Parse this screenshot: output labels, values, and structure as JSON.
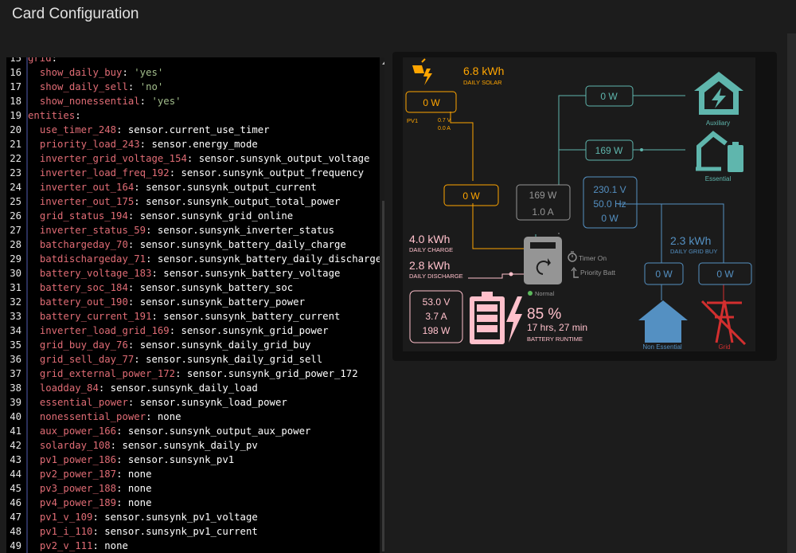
{
  "page": {
    "title": "Card Configuration"
  },
  "editor": {
    "lines": [
      {
        "n": "15",
        "key": "grid",
        "sep": ":",
        "val": "",
        "valType": "",
        "indent": 0
      },
      {
        "n": "16",
        "key": "show_daily_buy",
        "sep": ": ",
        "val": "'yes'",
        "valType": "s",
        "indent": 1
      },
      {
        "n": "17",
        "key": "show_daily_sell",
        "sep": ": ",
        "val": "'no'",
        "valType": "s",
        "indent": 1
      },
      {
        "n": "18",
        "key": "show_nonessential",
        "sep": ": ",
        "val": "'yes'",
        "valType": "s",
        "indent": 1
      },
      {
        "n": "19",
        "key": "entities",
        "sep": ":",
        "val": "",
        "valType": "",
        "indent": 0
      },
      {
        "n": "20",
        "key": "use_timer_248",
        "sep": ": ",
        "val": "sensor.current_use_timer",
        "valType": "p",
        "indent": 1
      },
      {
        "n": "21",
        "key": "priority_load_243",
        "sep": ": ",
        "val": "sensor.energy_mode",
        "valType": "p",
        "indent": 1
      },
      {
        "n": "22",
        "key": "inverter_grid_voltage_154",
        "sep": ": ",
        "val": "sensor.sunsynk_output_voltage",
        "valType": "p",
        "indent": 1
      },
      {
        "n": "23",
        "key": "inverter_load_freq_192",
        "sep": ": ",
        "val": "sensor.sunsynk_output_frequency",
        "valType": "p",
        "indent": 1
      },
      {
        "n": "24",
        "key": "inverter_out_164",
        "sep": ": ",
        "val": "sensor.sunsynk_output_current",
        "valType": "p",
        "indent": 1
      },
      {
        "n": "25",
        "key": "inverter_out_175",
        "sep": ": ",
        "val": "sensor.sunsynk_output_total_power",
        "valType": "p",
        "indent": 1
      },
      {
        "n": "26",
        "key": "grid_status_194",
        "sep": ": ",
        "val": "sensor.sunsynk_grid_online",
        "valType": "p",
        "indent": 1
      },
      {
        "n": "27",
        "key": "inverter_status_59",
        "sep": ": ",
        "val": "sensor.sunsynk_inverter_status",
        "valType": "p",
        "indent": 1
      },
      {
        "n": "28",
        "key": "batchargeday_70",
        "sep": ": ",
        "val": "sensor.sunsynk_battery_daily_charge",
        "valType": "p",
        "indent": 1
      },
      {
        "n": "29",
        "key": "batdischargeday_71",
        "sep": ": ",
        "val": "sensor.sunsynk_battery_daily_discharge",
        "valType": "p",
        "indent": 1
      },
      {
        "n": "30",
        "key": "battery_voltage_183",
        "sep": ": ",
        "val": "sensor.sunsynk_battery_voltage",
        "valType": "p",
        "indent": 1
      },
      {
        "n": "31",
        "key": "battery_soc_184",
        "sep": ": ",
        "val": "sensor.sunsynk_battery_soc",
        "valType": "p",
        "indent": 1
      },
      {
        "n": "32",
        "key": "battery_out_190",
        "sep": ": ",
        "val": "sensor.sunsynk_battery_power",
        "valType": "p",
        "indent": 1
      },
      {
        "n": "33",
        "key": "battery_current_191",
        "sep": ": ",
        "val": "sensor.sunsynk_battery_current",
        "valType": "p",
        "indent": 1
      },
      {
        "n": "34",
        "key": "inverter_load_grid_169",
        "sep": ": ",
        "val": "sensor.sunsynk_grid_power",
        "valType": "p",
        "indent": 1
      },
      {
        "n": "35",
        "key": "grid_buy_day_76",
        "sep": ": ",
        "val": "sensor.sunsynk_daily_grid_buy",
        "valType": "p",
        "indent": 1
      },
      {
        "n": "36",
        "key": "grid_sell_day_77",
        "sep": ": ",
        "val": "sensor.sunsynk_daily_grid_sell",
        "valType": "p",
        "indent": 1
      },
      {
        "n": "37",
        "key": "grid_external_power_172",
        "sep": ": ",
        "val": "sensor.sunsynk_grid_power_172",
        "valType": "p",
        "indent": 1
      },
      {
        "n": "38",
        "key": "loadday_84",
        "sep": ": ",
        "val": "sensor.sunsynk_daily_load",
        "valType": "p",
        "indent": 1
      },
      {
        "n": "39",
        "key": "essential_power",
        "sep": ": ",
        "val": "sensor.sunsynk_load_power",
        "valType": "p",
        "indent": 1
      },
      {
        "n": "40",
        "key": "nonessential_power",
        "sep": ": ",
        "val": "none",
        "valType": "p",
        "indent": 1
      },
      {
        "n": "41",
        "key": "aux_power_166",
        "sep": ": ",
        "val": "sensor.sunsynk_output_aux_power",
        "valType": "p",
        "indent": 1
      },
      {
        "n": "42",
        "key": "solarday_108",
        "sep": ": ",
        "val": "sensor.sunsynk_daily_pv",
        "valType": "p",
        "indent": 1
      },
      {
        "n": "43",
        "key": "pv1_power_186",
        "sep": ": ",
        "val": "sensor.sunsynk_pv1",
        "valType": "p",
        "indent": 1
      },
      {
        "n": "44",
        "key": "pv2_power_187",
        "sep": ": ",
        "val": "none",
        "valType": "p",
        "indent": 1
      },
      {
        "n": "45",
        "key": "pv3_power_188",
        "sep": ": ",
        "val": "none",
        "valType": "p",
        "indent": 1
      },
      {
        "n": "46",
        "key": "pv4_power_189",
        "sep": ": ",
        "val": "none",
        "valType": "p",
        "indent": 1
      },
      {
        "n": "47",
        "key": "pv1_v_109",
        "sep": ": ",
        "val": "sensor.sunsynk_pv1_voltage",
        "valType": "p",
        "indent": 1
      },
      {
        "n": "48",
        "key": "pv1_i_110",
        "sep": ": ",
        "val": "sensor.sunsynk_pv1_current",
        "valType": "p",
        "indent": 1
      },
      {
        "n": "49",
        "key": "pv2_v_111",
        "sep": ": ",
        "val": "none",
        "valType": "p",
        "indent": 1
      }
    ]
  },
  "card": {
    "solar": {
      "value": "6.8 kWh",
      "label": "DAILY SOLAR"
    },
    "pv1": {
      "power": "0 W",
      "name": "PV1",
      "voltage": "0.7 V",
      "current": "0.0 A"
    },
    "pv_total": "0 W",
    "aux": {
      "power": "0 W",
      "label": "Auxiliary"
    },
    "essential": {
      "power": "169 W",
      "label": "Essential"
    },
    "inverter_load": {
      "power": "169 W",
      "current": "1.0 A"
    },
    "inverter_out": {
      "voltage": "230.1 V",
      "freq": "50.0 Hz",
      "power": "0 W"
    },
    "battery": {
      "daily_charge": "4.0 kWh",
      "daily_charge_label": "DAILY CHARGE",
      "daily_discharge": "2.8 kWh",
      "daily_discharge_label": "DAILY DISCHARGE",
      "voltage": "53.0 V",
      "current": "3.7 A",
      "power": "198 W",
      "soc": "85 %",
      "runtime": "17 hrs, 27 min",
      "runtime_label": "BATTERY RUNTIME"
    },
    "inverter": {
      "status": "Normal",
      "timer": "Timer On",
      "priority": "Priority Batt"
    },
    "grid": {
      "daily_buy": "2.3 kWh",
      "daily_buy_label": "DAILY GRID BUY",
      "nonessential_power": "0 W",
      "grid_power": "0 W",
      "nonessential_label": "Non Essential",
      "grid_label": "Grid"
    },
    "colors": {
      "solar": "#ffa500",
      "load": "#5fb6ad",
      "grid": "#5490c2",
      "battery": "#ffc0cb",
      "inverter": "#959595",
      "grid_off": "#d32f2f"
    },
    "icons": [
      "solar-icon",
      "aux-house-icon",
      "essential-house-icon",
      "inverter-icon",
      "battery-icon",
      "bolt-icon",
      "nonessential-house-icon",
      "grid-tower-off-icon",
      "timer-icon",
      "priority-icon"
    ]
  }
}
